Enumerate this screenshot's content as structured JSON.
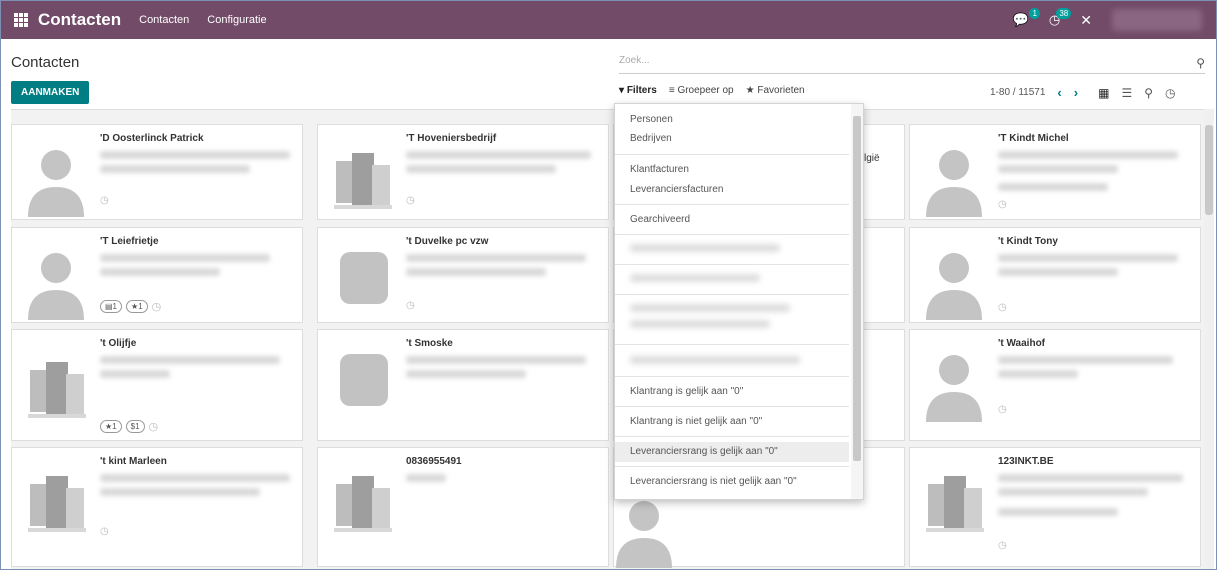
{
  "navbar": {
    "brand": "Contacten",
    "menu": [
      "Contacten",
      "Configuratie"
    ],
    "messages_count": "1",
    "activities_count": "38"
  },
  "page": {
    "title": "Contacten",
    "create_label": "AANMAKEN"
  },
  "search": {
    "placeholder": "Zoek...",
    "filters_label": "Filters",
    "groupby_label": "Groepeer op",
    "favorites_label": "Favorieten"
  },
  "pager": {
    "range": "1-80 / 11571"
  },
  "filters_menu": {
    "items": [
      "Personen",
      "Bedrijven",
      "Klantfacturen",
      "Leveranciersfacturen",
      "Gearchiveerd",
      "Klantrang is gelijk aan \"0\"",
      "Klantrang is niet gelijk aan \"0\"",
      "Leveranciersrang is gelijk aan \"0\"",
      "Leveranciersrang is niet gelijk aan \"0\""
    ]
  },
  "cards": [
    {
      "name": "'D Oosterlinck Patrick",
      "type": "person"
    },
    {
      "name": "'T Hoveniersbedrijf",
      "type": "company"
    },
    {
      "name": "'T Kindt Michel",
      "type": "person"
    },
    {
      "name": "'T Leiefrietje",
      "type": "person",
      "tags": [
        "▤1",
        "★1"
      ]
    },
    {
      "name": "'t Duvelke pc vzw",
      "type": "company"
    },
    {
      "name": "'t Kindt Tony",
      "type": "person"
    },
    {
      "name": "'t Olijfje",
      "type": "company",
      "tags": [
        "★1",
        "$1"
      ]
    },
    {
      "name": "'t Smoske",
      "type": "company"
    },
    {
      "name": "'t Waaihof",
      "type": "person"
    },
    {
      "name": "'t kint Marleen",
      "type": "company"
    },
    {
      "name": "0836955491",
      "type": "company"
    },
    {
      "name": "123INKT.BE",
      "type": "company"
    }
  ],
  "partial_text": {
    "belgie": "lgië"
  }
}
